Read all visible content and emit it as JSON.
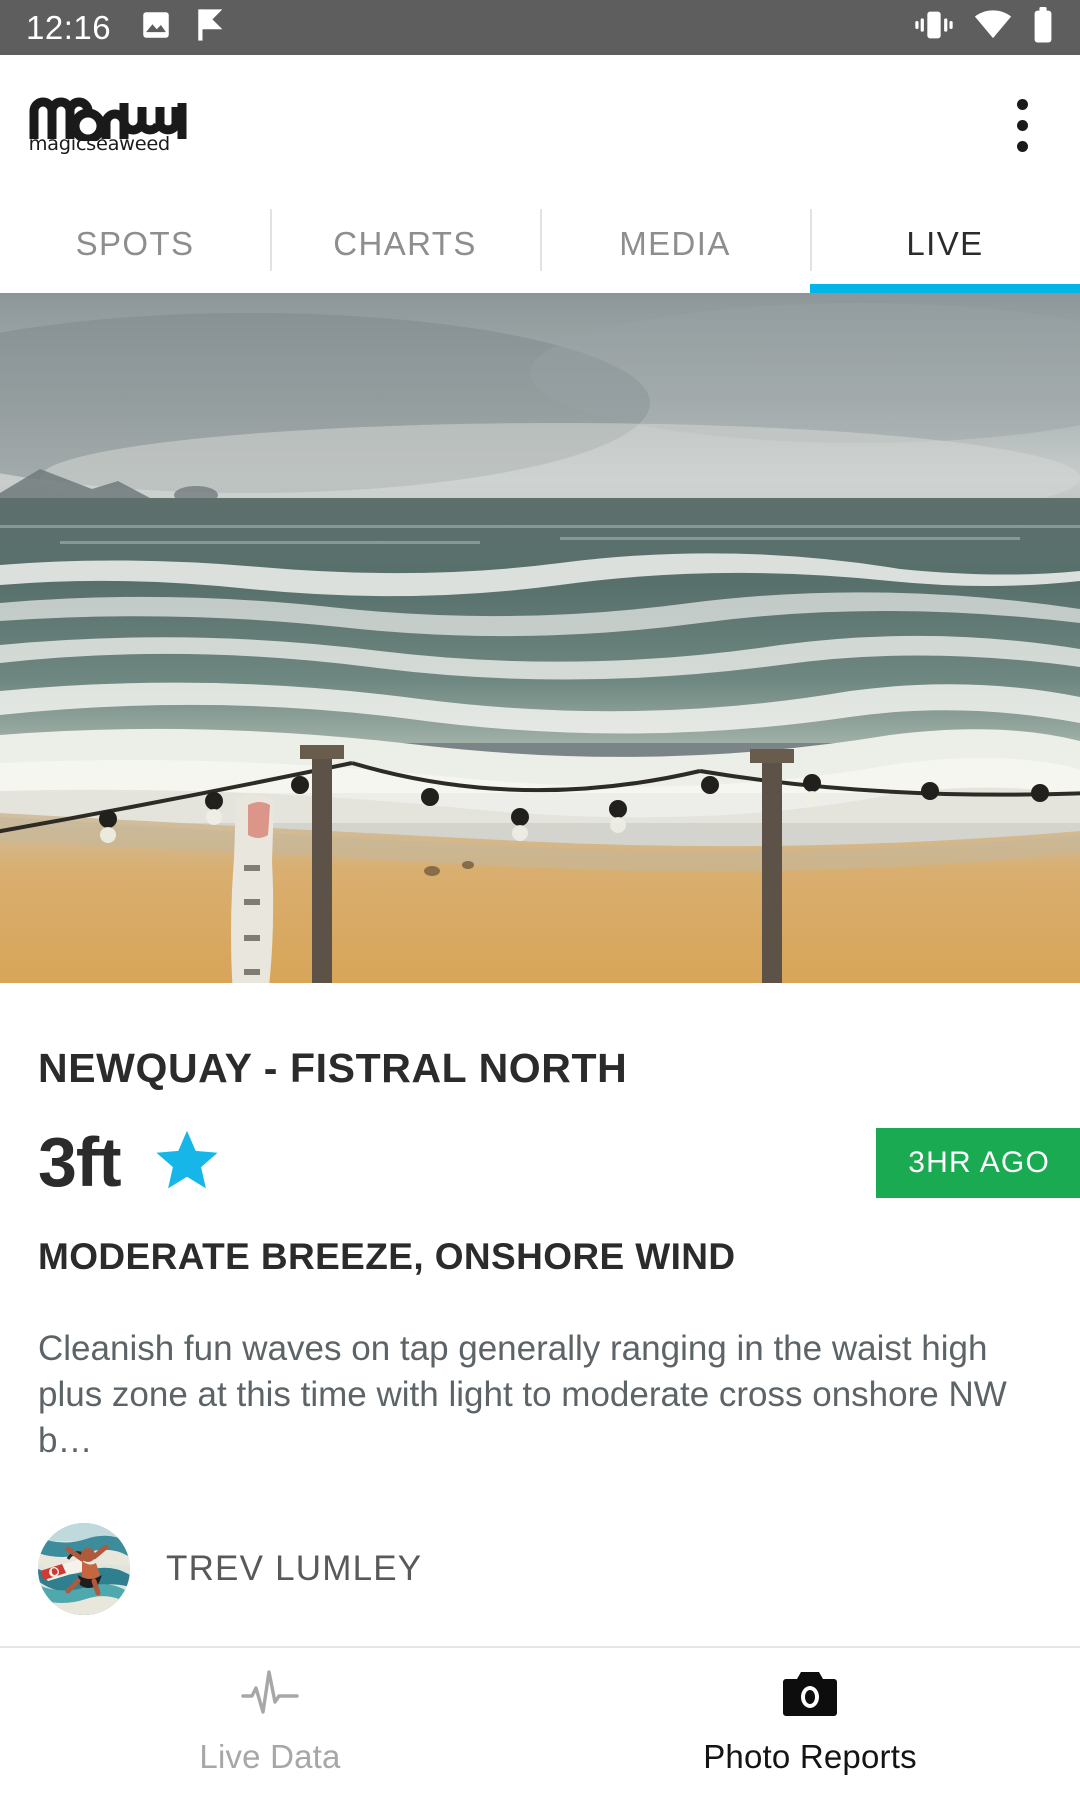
{
  "status_bar": {
    "time": "12:16",
    "left_icons": [
      "image-icon",
      "flag-check-icon"
    ],
    "right_icons": [
      "vibrate-icon",
      "wifi-icon",
      "battery-icon"
    ],
    "background": "#5e5e5e"
  },
  "app_bar": {
    "logo_mark": "msw",
    "logo_subtitle": "magicseaweed",
    "overflow_menu": "overflow-menu-icon"
  },
  "tabs": {
    "items": [
      {
        "label": "SPOTS",
        "active": false
      },
      {
        "label": "CHARTS",
        "active": false
      },
      {
        "label": "MEDIA",
        "active": false
      },
      {
        "label": "LIVE",
        "active": true
      }
    ],
    "indicator_color": "#00b6e8"
  },
  "webcam": {
    "alt": "live-beach-webcam-still"
  },
  "report": {
    "spot_name": "NEWQUAY - FISTRAL NORTH",
    "wave_height": "3ft",
    "rating_star": "star-icon",
    "star_color": "#16b7e8",
    "time_badge": "3HR AGO",
    "badge_color": "#1aaa52",
    "conditions": "MODERATE BREEZE, ONSHORE WIND",
    "description": "Cleanish fun waves on tap generally ranging in the  waist high plus zone at this time with light to moderate cross onshore NW b…",
    "author": "TREV LUMLEY",
    "avatar": "surfer-avatar"
  },
  "bottom_nav": {
    "items": [
      {
        "label": "Live Data",
        "icon": "pulse-icon",
        "active": false
      },
      {
        "label": "Photo Reports",
        "icon": "camera-icon",
        "active": true
      }
    ]
  }
}
